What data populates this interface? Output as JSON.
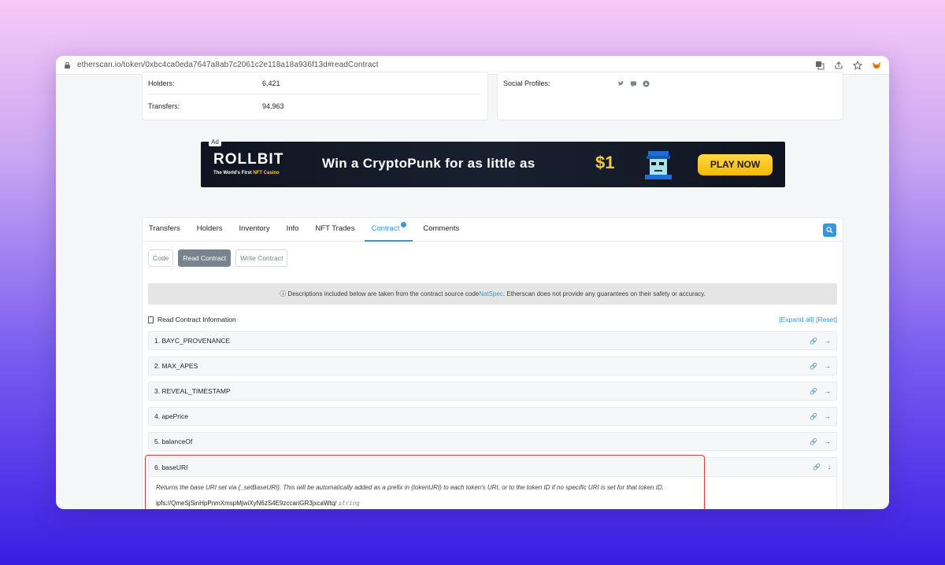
{
  "browser": {
    "url": "etherscan.io/token/0xbc4ca0eda7647a8ab7c2061c2e118a18a936f13d#readContract"
  },
  "stats": {
    "holders_label": "Holders:",
    "holders_value": "6,421",
    "transfers_label": "Transfers:",
    "transfers_value": "94,963",
    "social_label": "Social Profiles:"
  },
  "ad": {
    "tag": "Ad",
    "logo": "ROLLBIT",
    "sub_prefix": "The World's First",
    "sub_highlight": "NFT Casino",
    "headline": "Win a CryptoPunk for as little as",
    "price": "$1",
    "cta": "PLAY NOW"
  },
  "tabs": [
    "Transfers",
    "Holders",
    "Inventory",
    "Info",
    "NFT Trades",
    "Contract",
    "Comments"
  ],
  "active_tab": "Contract",
  "subtabs": [
    "Code",
    "Read Contract",
    "Write Contract"
  ],
  "notice": {
    "prefix": "ⓘ Descriptions included below are taken from the contract source code ",
    "link": "NatSpec",
    "suffix": ". Etherscan does not provide any guarantees on their safety or accuracy."
  },
  "read_info": {
    "title": "Read Contract Information",
    "expand": "[Expand all]",
    "reset": "[Reset]"
  },
  "functions": [
    "1. BAYC_PROVENANCE",
    "2. MAX_APES",
    "3. REVEAL_TIMESTAMP",
    "4. apePrice",
    "5. balanceOf"
  ],
  "expanded_function": {
    "name": "6. baseURI",
    "description": "Returns the base URI set via {_setBaseURI}. This will be automatically added as a prefix in {tokenURI} to each token's URI, or to the token ID if no specific URI is set for that token ID.",
    "value": "ipfs://QmeSjSinHpPnmXmspMjwiXyN6zS4E9zccariGR3jxcaWtq/",
    "type": "string"
  },
  "colors": {
    "accent": "#3498db",
    "highlight": "#e53935",
    "ad_yellow": "#f6c945"
  }
}
